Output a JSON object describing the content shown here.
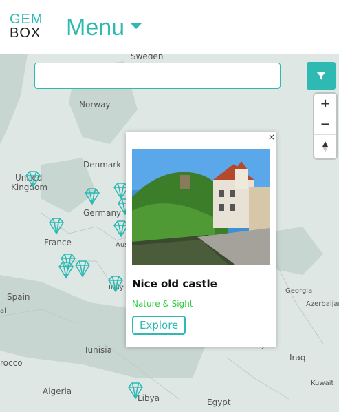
{
  "header": {
    "logo_top": "GEM",
    "logo_bottom": "BOX",
    "menu_label": "Menu"
  },
  "search": {
    "value": "",
    "placeholder": ""
  },
  "controls": {
    "zoom_in": "+",
    "zoom_out": "−",
    "reset_north": "▲"
  },
  "map_labels": {
    "sweden": "Sweden",
    "norway": "Norway",
    "denmark": "Denmark",
    "united_kingdom_1": "United",
    "united_kingdom_2": "Kingdom",
    "germany": "Germany",
    "france": "France",
    "austria": "Aus",
    "italy": "Italy",
    "spain": "Spain",
    "portugal": "al",
    "tunisia": "Tunisia",
    "morocco": "rocco",
    "algeria": "Algeria",
    "libya": "Libya",
    "egypt": "Egypt",
    "georgia": "Georgia",
    "azerbaijan": "Azerbaijan",
    "iraq": "Iraq",
    "kuwait": "Kuwait",
    "syria": "yria"
  },
  "popup": {
    "close": "×",
    "title": "Nice old castle",
    "category": "Nature & Sight",
    "action": "Explore"
  },
  "colors": {
    "accent": "#2fb9b3",
    "category_green": "#2ecc40",
    "map_land": "#dfe7e4",
    "map_water": "#c8d6d1"
  }
}
